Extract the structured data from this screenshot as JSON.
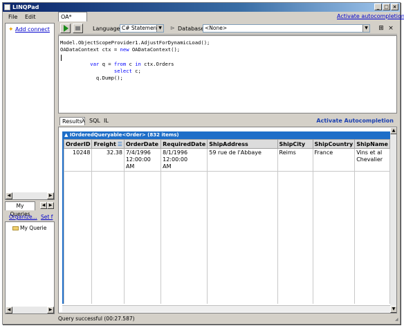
{
  "window": {
    "title": "LINQPad"
  },
  "menu": {
    "file_label": "File",
    "edit_label": "Edit"
  },
  "left_pane": {
    "add_connection_label": "Add connect",
    "my_queries_tab_label": "My Queries",
    "organize_link": "Organize...",
    "set_folder_link": "Set f",
    "tree_root_label": "My Querie"
  },
  "query_tab": {
    "label": "OA*"
  },
  "top_link": {
    "label": "Activate autocompletion"
  },
  "toolbar": {
    "language_label": "Language",
    "language_value": "C# Statement(s)",
    "database_label": "Database",
    "database_value": "<None>"
  },
  "editor": {
    "lines": [
      "Model.ObjectScopeProvider1.AdjustForDynamicLoad();",
      "OADataContext ctx = new OADataContext();",
      "",
      "          var q = from c in ctx.Orders",
      "                  select c;",
      "            q.Dump();"
    ]
  },
  "results_tabs": {
    "results_label": "Results",
    "lambda_label": "λ",
    "sql_label": "SQL",
    "il_label": "IL",
    "activate_label": "Activate Autocompletion"
  },
  "results": {
    "header": "IOrderedQueryable<Order> (832 items)",
    "columns": [
      "OrderID",
      "Freight",
      "OrderDate",
      "RequiredDate",
      "ShipAddress",
      "ShipCity",
      "ShipCountry",
      "ShipName"
    ],
    "rows": [
      [
        "10248",
        "32.38",
        "7/4/1996\n12:00:00\nAM",
        "8/1/1996\n12:00:00\nAM",
        "59 rue de l'Abbaye",
        "Reims",
        "France",
        "Vins et al\nChevalier"
      ]
    ]
  },
  "status": {
    "text": "Query successful  (00:27.587)"
  }
}
